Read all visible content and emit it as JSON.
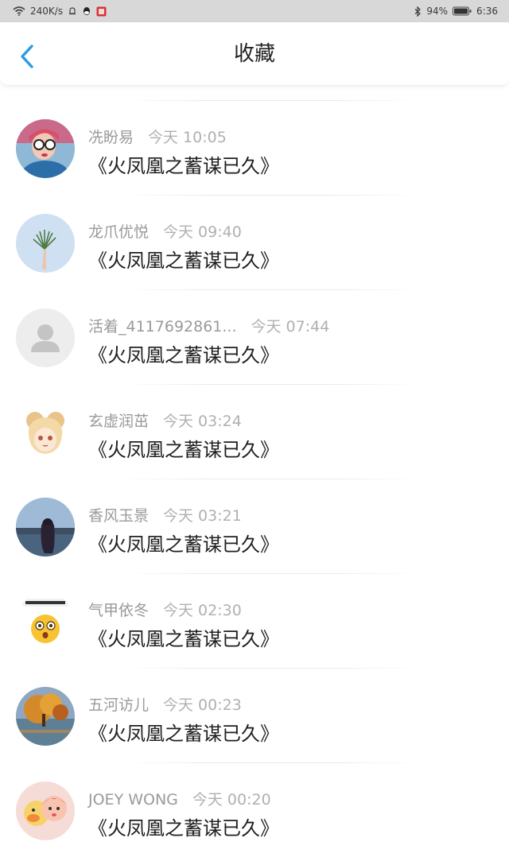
{
  "status_bar": {
    "network_speed": "240K/s",
    "battery_percent": "94%",
    "time": "6:36"
  },
  "header": {
    "title": "收藏"
  },
  "favorites": [
    {
      "user": "冼盼易",
      "time": "今天 10:05",
      "content": "《火凤凰之蓄谋已久》",
      "avatar": "girl-with-sunglasses"
    },
    {
      "user": "龙爪优悦",
      "time": "今天 09:40",
      "content": "《火凤凰之蓄谋已久》",
      "avatar": "hand-holding-plant"
    },
    {
      "user": "活着_4117692861...",
      "time": "今天 07:44",
      "content": "《火凤凰之蓄谋已久》",
      "avatar": "default-person"
    },
    {
      "user": "玄虚润茁",
      "time": "今天 03:24",
      "content": "《火凤凰之蓄谋已久》",
      "avatar": "anime-character"
    },
    {
      "user": "香风玉景",
      "time": "今天 03:21",
      "content": "《火凤凰之蓄谋已久》",
      "avatar": "girl-by-lake"
    },
    {
      "user": "气甲依冬",
      "time": "今天 02:30",
      "content": "《火凤凰之蓄谋已久》",
      "avatar": "surprised-emoji"
    },
    {
      "user": "五河访儿",
      "time": "今天 00:23",
      "content": "《火凤凰之蓄谋已久》",
      "avatar": "autumn-tree-lake"
    },
    {
      "user": "JOEY WONG",
      "time": "今天 00:20",
      "content": "《火凤凰之蓄谋已久》",
      "avatar": "cartoon-duck-girl"
    }
  ],
  "colors": {
    "accent": "#2b9be0",
    "status_bar_bg": "#d8d8d8",
    "meta_text": "#9a9a9a",
    "content_text": "#1f1f1f"
  }
}
